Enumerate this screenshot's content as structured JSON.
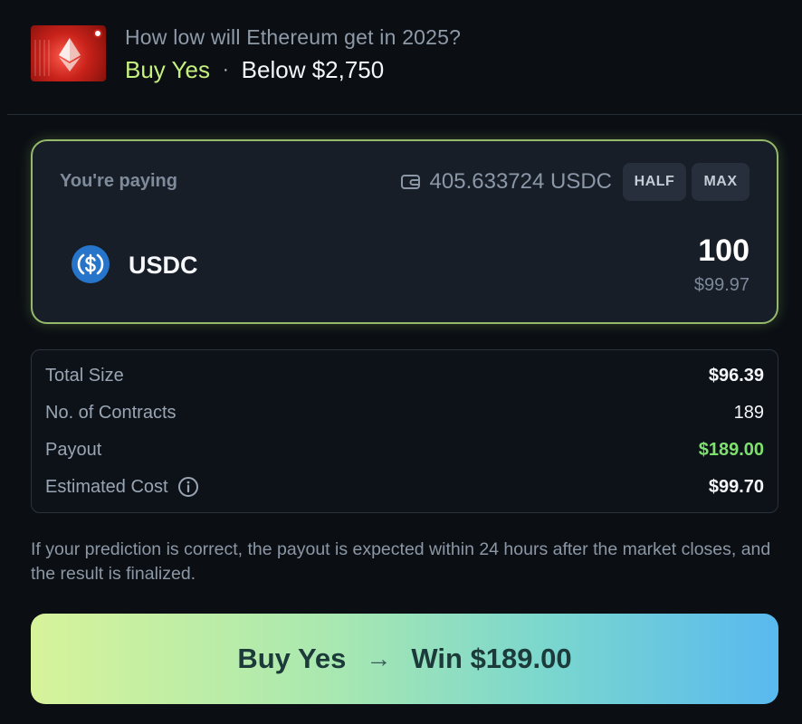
{
  "market": {
    "title": "How low will Ethereum get in 2025?",
    "side": "Buy Yes",
    "separator": "·",
    "outcome": "Below $2,750",
    "thumbnail_icon": "ethereum-market-thumbnail"
  },
  "paying": {
    "label": "You're paying",
    "balance": "405.633724 USDC",
    "half_label": "HALF",
    "max_label": "MAX",
    "token": "USDC",
    "amount": "100",
    "amount_usd": "$99.97"
  },
  "summary": {
    "rows": [
      {
        "label": "Total Size",
        "value": "$96.39"
      },
      {
        "label": "No. of Contracts",
        "value": "189"
      },
      {
        "label": "Payout",
        "value": "$189.00"
      },
      {
        "label": "Estimated Cost",
        "value": "$99.70"
      }
    ]
  },
  "note": "If your prediction is correct, the payout is expected within 24 hours after the market closes, and the result is finalized.",
  "cta": {
    "action": "Buy Yes",
    "arrow": "→",
    "result": "Win $189.00"
  },
  "colors": {
    "accent_green": "#c6f07d",
    "payout_green": "#7ee06e",
    "card_border": "#96b86a",
    "usdc_blue": "#2775ca"
  }
}
